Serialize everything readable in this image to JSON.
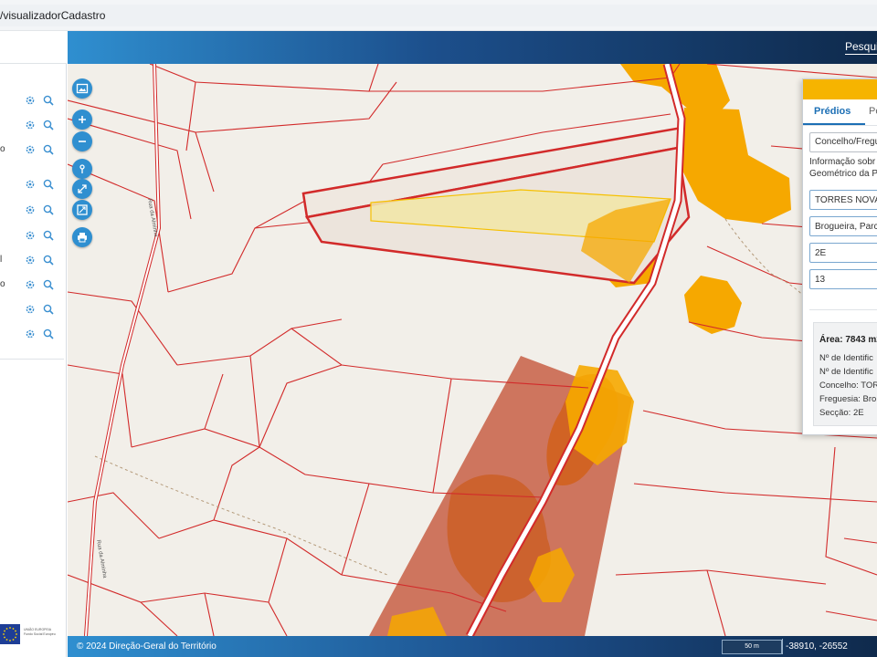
{
  "browser": {
    "url_text": "/visualizadorCadastro"
  },
  "header": {
    "search_tab": "Pesqui"
  },
  "sidebar": {
    "rows": [
      {
        "fragment": ""
      },
      {
        "fragment": ""
      },
      {
        "fragment": "o"
      },
      {
        "fragment": ""
      },
      {
        "fragment": ""
      },
      {
        "fragment": ""
      },
      {
        "fragment": "l"
      },
      {
        "fragment": "o"
      },
      {
        "fragment": ""
      },
      {
        "fragment": ""
      }
    ],
    "eu_text": [
      "UNIÃO EUROPEIA",
      "Fundo Social Europeu"
    ]
  },
  "panel": {
    "tabs": [
      "Prédios",
      "Pe"
    ],
    "select_value": "Concelho/Fregu",
    "info_line1": "Informação sobr",
    "info_line2": "Geométrico da P",
    "fields": [
      "TORRES NOVAS",
      "Brogueira, Parc",
      "2E",
      "13"
    ],
    "result": {
      "area": "Área: 7843 m2",
      "lines": [
        "Nº de Identific",
        "Nº de Identific",
        "Concelho: TOR",
        "Freguesia: Bro",
        "Secção: 2E"
      ]
    }
  },
  "map": {
    "road_labels": [
      "Rua da Alminha",
      "Rua da Alminha"
    ],
    "tools": [
      "image-icon",
      "zoom-in-icon",
      "zoom-out-icon",
      "locate-icon",
      "fullscreen-icon",
      "extent-icon",
      "print-icon"
    ]
  },
  "footer": {
    "copyright": "© 2024 Direção-Geral do Território",
    "scale": "50 m",
    "coords": "-38910, -26552"
  },
  "colors": {
    "brand_blue": "#2f8fd0",
    "header_dark": "#0f2a4c",
    "parcel_red": "#d22a2a",
    "selected_parcel": "#f2e6a8",
    "fire_orange": "#f6a800",
    "burnt_brown": "#c8644a",
    "panel_header": "#f6b400"
  }
}
